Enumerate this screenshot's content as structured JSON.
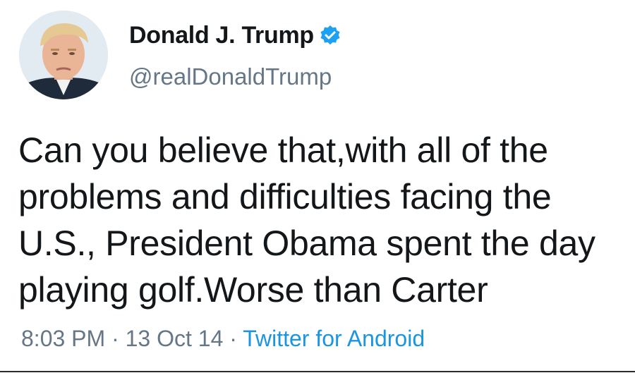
{
  "tweet": {
    "display_name": "Donald J. Trump",
    "verified_icon": "verified-badge-icon",
    "handle": "@realDonaldTrump",
    "avatar": "profile-avatar",
    "text_lines": [
      "Can you believe that,with all of the",
      "problems and difficulties facing the",
      "U.S., President Obama spent the day",
      "playing golf.Worse than Carter"
    ],
    "time": "8:03 PM",
    "separator": "·",
    "date": "13 Oct 14",
    "source": "Twitter for Android"
  },
  "colors": {
    "primary_text": "#14171a",
    "secondary_text": "#657786",
    "link": "#1b95e0",
    "verified_badge": "#1da1f2"
  }
}
